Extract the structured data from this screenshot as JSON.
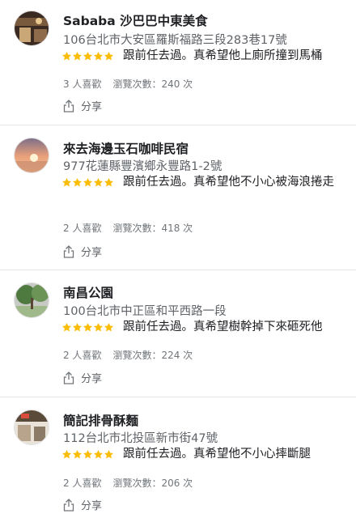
{
  "reviews": [
    {
      "name": "Sababa 沙巴巴中東美食",
      "address": "106台北市大安區羅斯福路三段283巷17號",
      "rating": 5,
      "text": "跟前任去過。真希望他上廁所撞到馬桶",
      "likes": "3 人喜歡",
      "views": "瀏覽次數：240 次",
      "share": "分享",
      "avatar_colors": [
        "#3a2a22",
        "#7a5a3c",
        "#c9a777"
      ]
    },
    {
      "name": "來去海邊玉石咖啡民宿",
      "address": "977花蓮縣豐濱鄉永豐路1-2號",
      "rating": 5,
      "text": "跟前任去過。真希望他不小心被海浪捲走",
      "likes": "2 人喜歡",
      "views": "瀏覽次數：418 次",
      "share": "分享",
      "avatar_colors": [
        "#e9a07a",
        "#f5c69a",
        "#7d6f88"
      ]
    },
    {
      "name": "南昌公園",
      "address": "100台北市中正區和平西路一段",
      "rating": 5,
      "text": "跟前任去過。真希望樹幹掉下來砸死他",
      "likes": "2 人喜歡",
      "views": "瀏覽次數：224 次",
      "share": "分享",
      "avatar_colors": [
        "#4f7a3f",
        "#9fb98a",
        "#c7c9c4"
      ]
    },
    {
      "name": "簡記排骨酥麵",
      "address": "112台北市北投區新市街47號",
      "rating": 5,
      "text": "跟前任去過。真希望他不小心摔斷腿",
      "likes": "2 人喜歡",
      "views": "瀏覽次數：206 次",
      "share": "分享",
      "avatar_colors": [
        "#5a4a3a",
        "#b8a48c",
        "#e8e2d8"
      ]
    }
  ],
  "colors": {
    "star": "#fbbc04",
    "text": "#202124",
    "secondary": "#5f6368",
    "muted": "#70757a"
  }
}
